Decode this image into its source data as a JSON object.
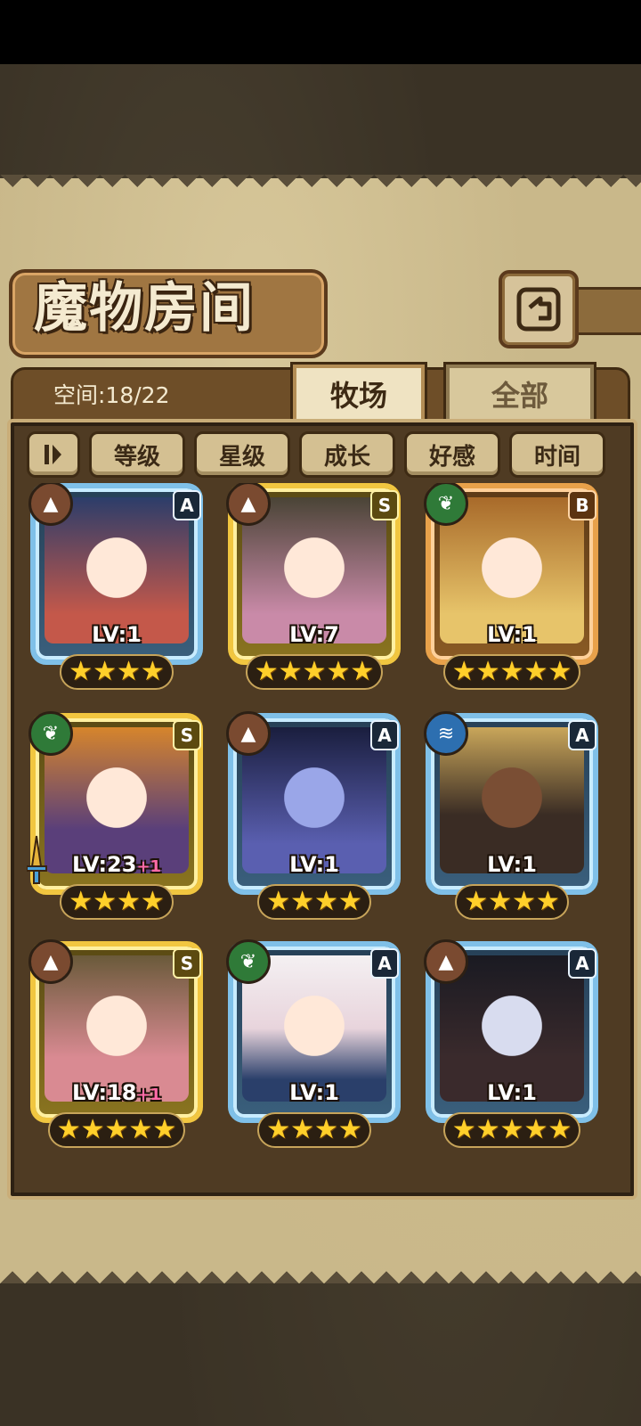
{
  "screen": {
    "title": "魔物房间",
    "capacity_text": "空间:18/22",
    "tabs": [
      {
        "label": "牧场",
        "active": true
      },
      {
        "label": "全部",
        "active": false
      }
    ],
    "filters": [
      "等级",
      "星级",
      "成长",
      "好感",
      "时间"
    ]
  },
  "monsters": [
    {
      "rank": "A",
      "element": "earth-icon",
      "level": "LV:1",
      "bonus": "",
      "stars": 4,
      "frame_color": "#7fc0e8",
      "portrait_color": "#c4584a"
    },
    {
      "rank": "S",
      "element": "earth-icon",
      "level": "LV:7",
      "bonus": "",
      "stars": 5,
      "frame_color": "#f1c640",
      "portrait_color": "#c98aa8"
    },
    {
      "rank": "B",
      "element": "nature-icon",
      "level": "LV:1",
      "bonus": "",
      "stars": 5,
      "frame_color": "#e8a14a",
      "portrait_color": "#e7c46a"
    },
    {
      "rank": "S",
      "element": "nature-icon",
      "level": "LV:23",
      "bonus": "+1",
      "stars": 4,
      "frame_color": "#f1c640",
      "portrait_color": "#5a3f7a"
    },
    {
      "rank": "A",
      "element": "earth-icon",
      "level": "LV:1",
      "bonus": "",
      "stars": 4,
      "frame_color": "#7fc0e8",
      "portrait_color": "#5a5fb0"
    },
    {
      "rank": "A",
      "element": "water-icon",
      "level": "LV:1",
      "bonus": "",
      "stars": 4,
      "frame_color": "#7fc0e8",
      "portrait_color": "#3a2c24"
    },
    {
      "rank": "S",
      "element": "earth-icon",
      "level": "LV:18",
      "bonus": "+1",
      "stars": 5,
      "frame_color": "#f1c640",
      "portrait_color": "#d98a92"
    },
    {
      "rank": "A",
      "element": "nature-icon",
      "level": "LV:1",
      "bonus": "",
      "stars": 4,
      "frame_color": "#7fc0e8",
      "portrait_color": "#e8d4dc"
    },
    {
      "rank": "A",
      "element": "earth-icon",
      "level": "LV:1",
      "bonus": "",
      "stars": 5,
      "frame_color": "#7fc0e8",
      "portrait_color": "#3a2a2c"
    }
  ]
}
